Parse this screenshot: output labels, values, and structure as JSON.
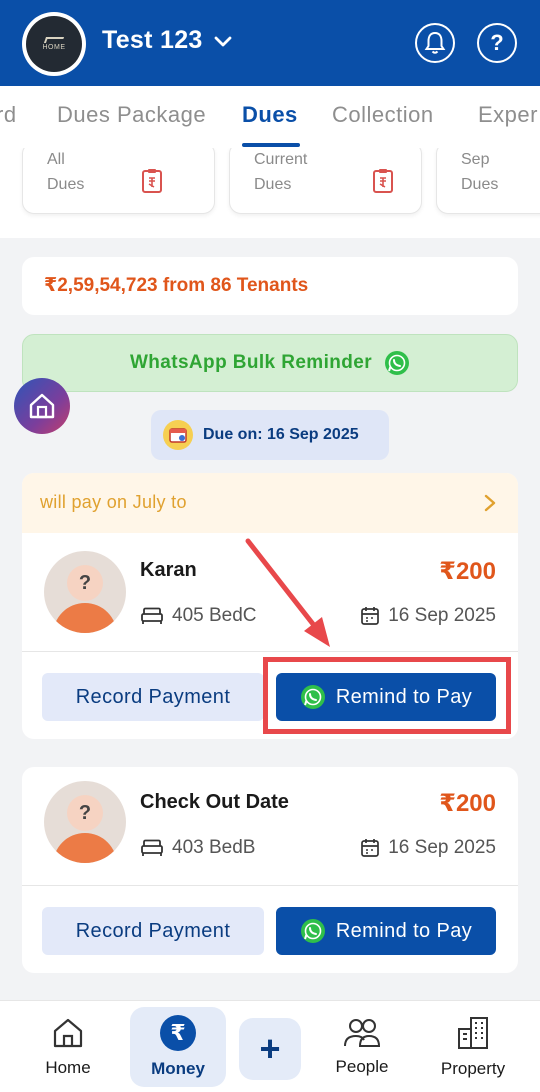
{
  "header": {
    "logo_text": "HOME",
    "title": "Test 123",
    "help_glyph": "?"
  },
  "tabs": [
    {
      "label": "rd",
      "active": false
    },
    {
      "label": "Dues Package",
      "active": false
    },
    {
      "label": "Dues",
      "active": true
    },
    {
      "label": "Collection",
      "active": false
    },
    {
      "label": "Exper",
      "active": false
    }
  ],
  "summary_cards": [
    {
      "line1": "All",
      "line2": "Dues"
    },
    {
      "line1": "Current",
      "line2": "Dues"
    },
    {
      "line1": "Sep",
      "line2": "Dues"
    }
  ],
  "total": {
    "text": "₹2,59,54,723 from 86 Tenants"
  },
  "bulk_reminder": {
    "label": "WhatsApp Bulk Reminder"
  },
  "due_chip": {
    "label": "Due on: 16 Sep 2025"
  },
  "tenants": [
    {
      "banner": "will pay on July to",
      "avatar_glyph": "?",
      "name": "Karan",
      "amount": "₹200",
      "room": "405 BedC",
      "date": "16 Sep 2025",
      "record_label": "Record Payment",
      "remind_label": "Remind to Pay"
    },
    {
      "avatar_glyph": "?",
      "name": "Check Out Date",
      "amount": "₹200",
      "room": "403 BedB",
      "date": "16 Sep 2025",
      "record_label": "Record Payment",
      "remind_label": "Remind to Pay"
    }
  ],
  "bottom_nav": {
    "home": "Home",
    "money": "Money",
    "money_glyph": "₹",
    "add_glyph": "+",
    "people": "People",
    "property": "Property"
  },
  "colors": {
    "brand": "#0a4fa8",
    "amount": "#e0561b",
    "whatsapp": "#2fa534",
    "annotation": "#e8484b"
  }
}
